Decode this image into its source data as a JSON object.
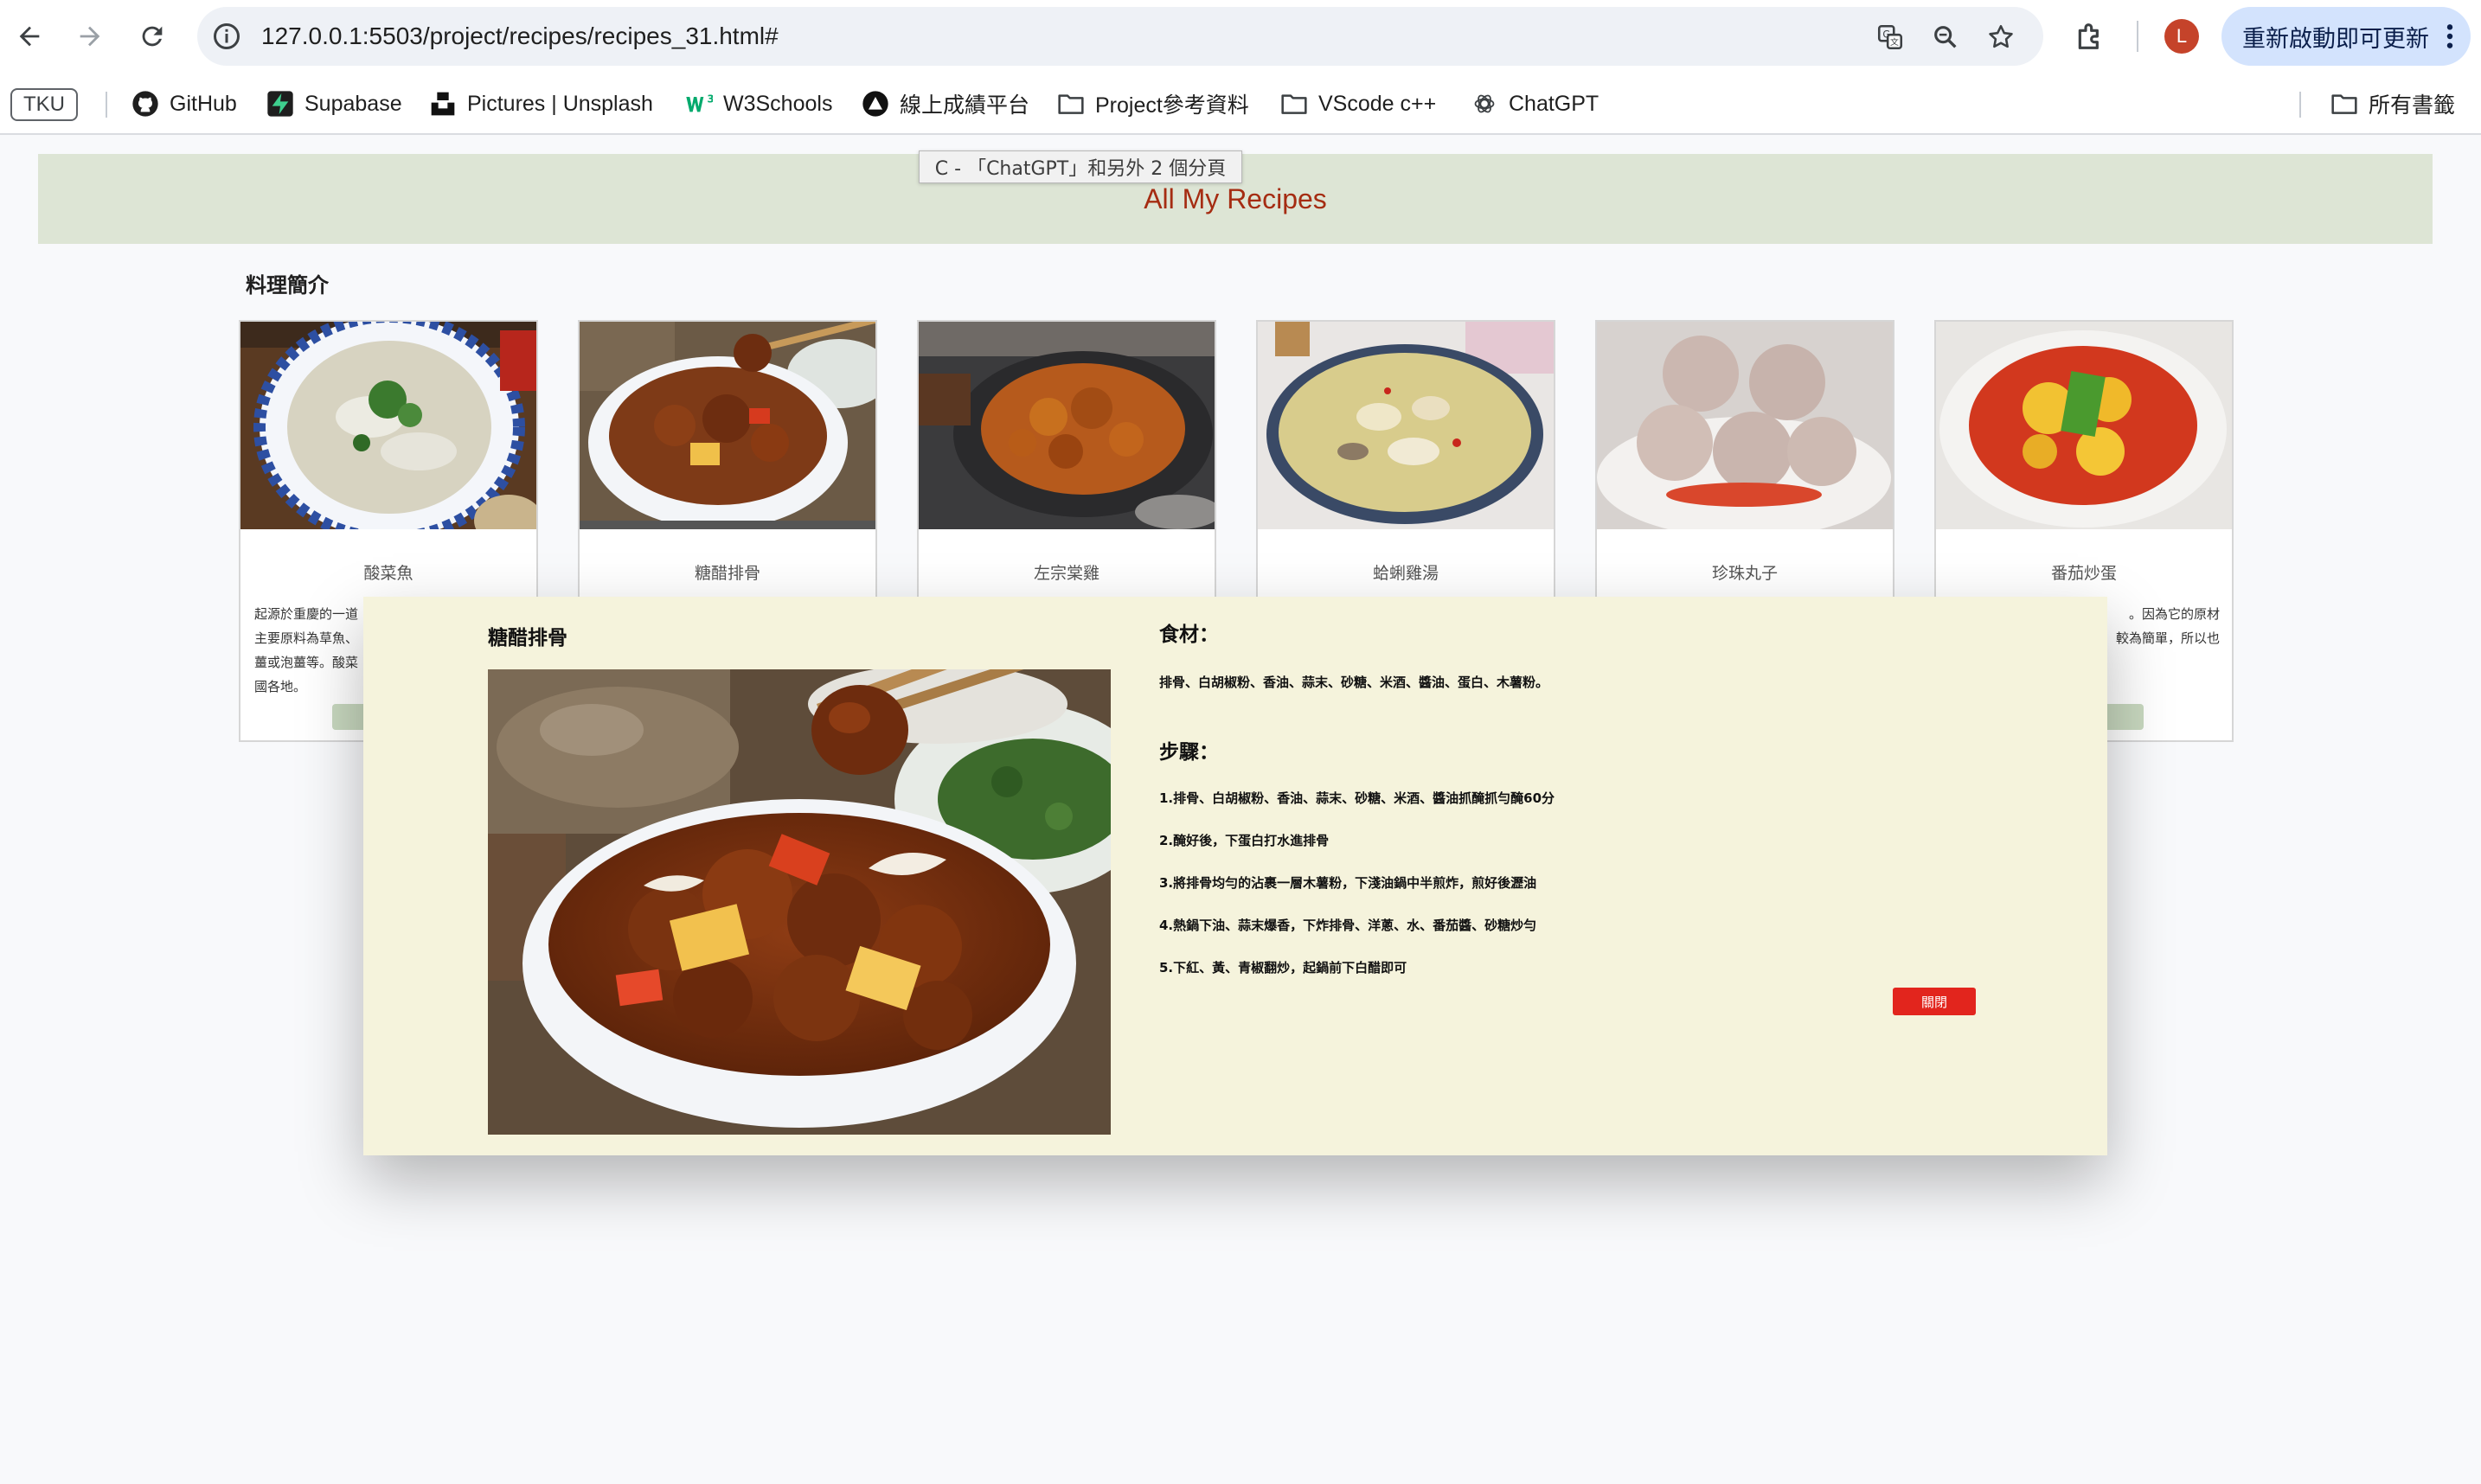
{
  "browser": {
    "url": "127.0.0.1:5503/project/recipes/recipes_31.html#",
    "avatar_letter": "L",
    "update_label": "重新啟動即可更新",
    "tooltip": "C - 「ChatGPT」和另外 2 個分頁"
  },
  "bookmarks": {
    "tku": "TKU",
    "items": [
      "GitHub",
      "Supabase",
      "Pictures | Unsplash",
      "W3Schools",
      "線上成績平台",
      "Project參考資料",
      "VScode c++",
      "ChatGPT"
    ],
    "all_bookmarks": "所有書籤"
  },
  "page": {
    "title": "All My Recipes",
    "section_title": "料理簡介"
  },
  "cards": [
    {
      "name": "酸菜魚",
      "desc_lines": [
        "起源於重慶的一道",
        "主要原料為草魚、",
        "薑或泡薑等。酸菜",
        "國各地。"
      ]
    },
    {
      "name": "糖醋排骨",
      "desc_lines": []
    },
    {
      "name": "左宗棠雞",
      "desc_lines": []
    },
    {
      "name": "蛤蜊雞湯",
      "desc_lines": []
    },
    {
      "name": "珍珠丸子",
      "desc_lines": []
    },
    {
      "name": "番茄炒蛋",
      "desc_lines": [
        "",
        "。因為它的原材",
        "較為簡單，所以也"
      ]
    }
  ],
  "modal": {
    "title": "糖醋排骨",
    "ingredients_heading": "食材：",
    "ingredients": "排骨、白胡椒粉、香油、蒜末、砂糖、米酒、醬油、蛋白、木薯粉。",
    "steps_heading": "步驟：",
    "steps": [
      "1.排骨、白胡椒粉、香油、蒜末、砂糖、米酒、醬油抓醃抓勻醃60分",
      "2.醃好後，下蛋白打水進排骨",
      "3.將排骨均勻的沾裹一層木薯粉，下淺油鍋中半煎炸，煎好後瀝油",
      "4.熱鍋下油、蒜末爆香，下炸排骨、洋蔥、水、番茄醬、砂糖炒勻",
      "5.下紅、黃、青椒翻炒，起鍋前下白醋即可"
    ],
    "close_label": "關閉"
  },
  "colors": {
    "header_band": "#dde5d5",
    "title_text": "#a52c12",
    "modal_bg": "#f5f3dc",
    "close_button": "#e2251d",
    "card_button": "#c8d8bf"
  }
}
